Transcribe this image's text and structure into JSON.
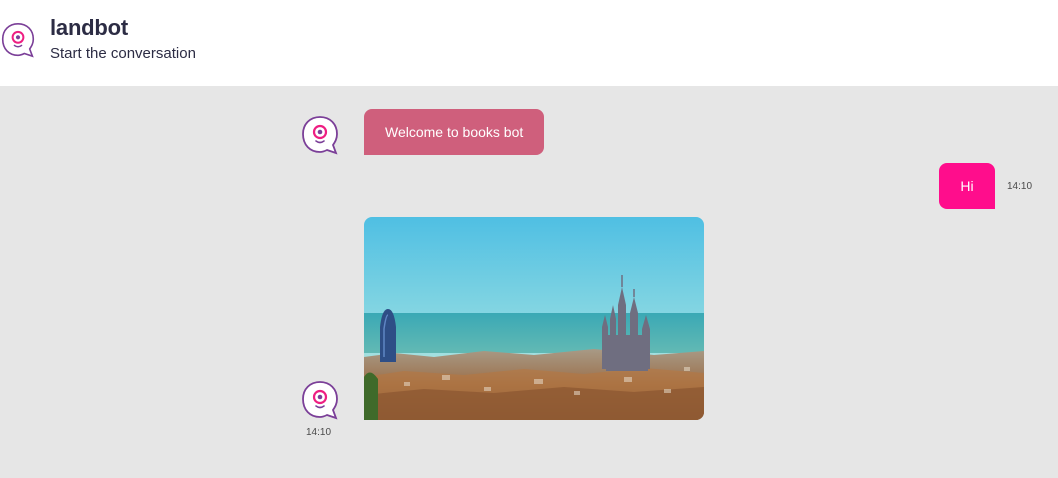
{
  "header": {
    "title": "landbot",
    "subtitle": "Start the conversation",
    "logo_icon": "landbot-logo-icon"
  },
  "messages": [
    {
      "from": "bot",
      "type": "text",
      "text": "Welcome to books bot"
    },
    {
      "from": "user",
      "type": "text",
      "text": "Hi",
      "time": "14:10"
    },
    {
      "from": "bot",
      "type": "image",
      "icon": "city-skyline-photo",
      "time": "14:10"
    }
  ],
  "colors": {
    "bot_bubble": "#cf5f7c",
    "user_bubble": "#ff0d8c",
    "brand_purple": "#7b3f98",
    "brand_pink": "#ee1e82",
    "chat_background": "#e6e6e6"
  }
}
